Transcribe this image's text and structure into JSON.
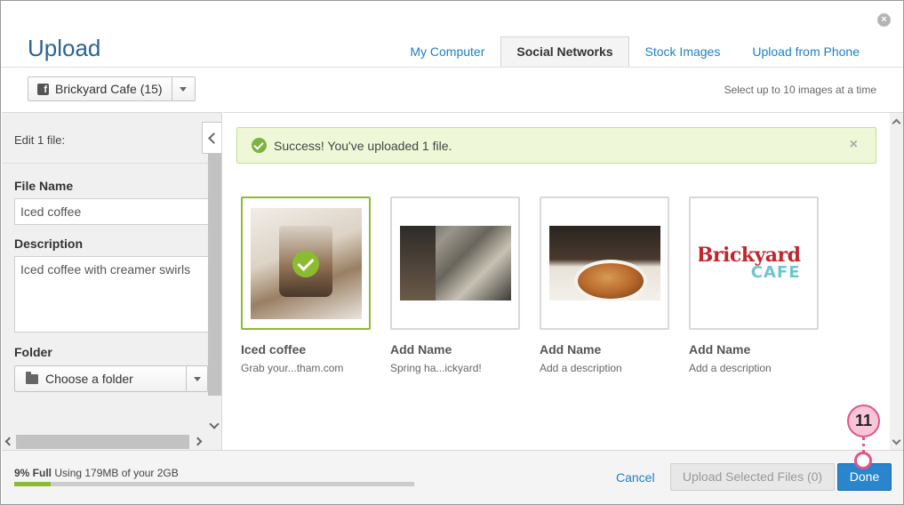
{
  "dialog": {
    "title": "Upload",
    "tabs": [
      {
        "label": "My Computer",
        "active": false
      },
      {
        "label": "Social Networks",
        "active": true
      },
      {
        "label": "Stock Images",
        "active": false
      },
      {
        "label": "Upload from Phone",
        "active": false
      }
    ],
    "close_icon": "close-circle-icon"
  },
  "account_select": {
    "icon": "facebook-icon",
    "value": "Brickyard Cafe (15)"
  },
  "select_hint": "Select up to 10 images at a time",
  "edit_panel": {
    "heading": "Edit 1 file:",
    "file_name_label": "File Name",
    "file_name_value": "Iced coffee",
    "description_label": "Description",
    "description_value": "Iced coffee with creamer swirls",
    "folder_label": "Folder",
    "folder_value": "Choose a folder"
  },
  "success_message": {
    "text": "Success! You've uploaded 1 file.",
    "close": "×"
  },
  "images": [
    {
      "name": "Iced coffee",
      "description": "Grab your...tham.com",
      "selected": true
    },
    {
      "name": "Add Name",
      "description": "Spring ha...ickyard!",
      "selected": false
    },
    {
      "name": "Add Name",
      "description": "Add a description",
      "selected": false
    },
    {
      "name": "Add Name",
      "description": "Add a description",
      "selected": false
    }
  ],
  "logo": {
    "line1": "Brickyard",
    "line2": "CAFE"
  },
  "storage": {
    "percent_label": "9% Full",
    "usage_text": "Using 179MB of your 2GB",
    "fraction": 0.09
  },
  "footer": {
    "cancel_label": "Cancel",
    "upload_label": "Upload Selected Files (0)",
    "done_label": "Done"
  },
  "step_marker": "11",
  "colors": {
    "accent": "#1f7fc8",
    "primary_button": "#2a86cc",
    "success_bg": "#eff7d9",
    "selected_border": "#8dbb2f",
    "step_marker": "#e0558a"
  }
}
